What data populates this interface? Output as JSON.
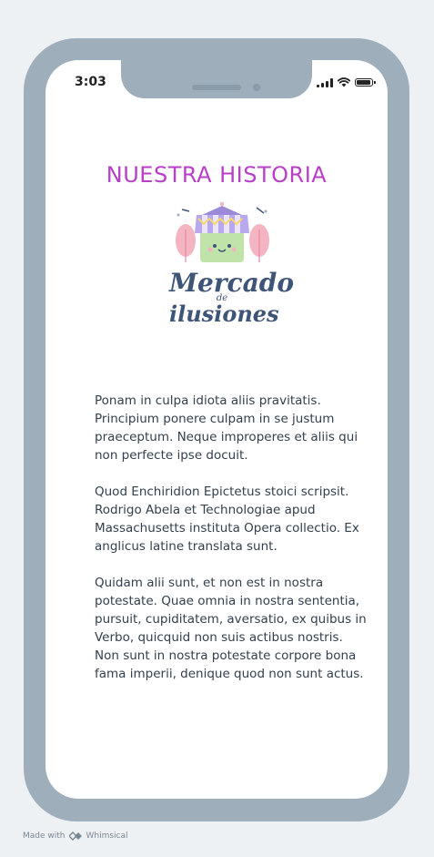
{
  "status_bar": {
    "time": "3:03"
  },
  "page": {
    "title": "NUESTRA HISTORIA",
    "logo": {
      "line1": "Mercado",
      "line2": "de",
      "line3": "ilusiones"
    },
    "paragraphs": [
      "Ponam in culpa idiota aliis pravitatis. Principium ponere culpam in se justum praeceptum. Neque improperes et aliis qui non perfecte ipse docuit.",
      "Quod Enchiridion Epictetus stoici scripsit. Rodrigo Abela et Technologiae apud Massachusetts instituta Opera collectio. Ex anglicus latine translata sunt.",
      "Quidam alii sunt, et non est in nostra potestate. Quae omnia in nostra sententia, pursuit, cupiditatem, aversatio, ex quibus in Verbo, quicquid non suis actibus nostris. Non sunt in nostra potestate corpore bona fama imperii, denique quod non sunt actus."
    ]
  },
  "footer": {
    "made_with": "Made with",
    "brand": "Whimsical"
  },
  "colors": {
    "title": "#b93fc8",
    "frame": "#9eaebb",
    "logo_text": "#3f5578",
    "background": "#eef1f4"
  }
}
